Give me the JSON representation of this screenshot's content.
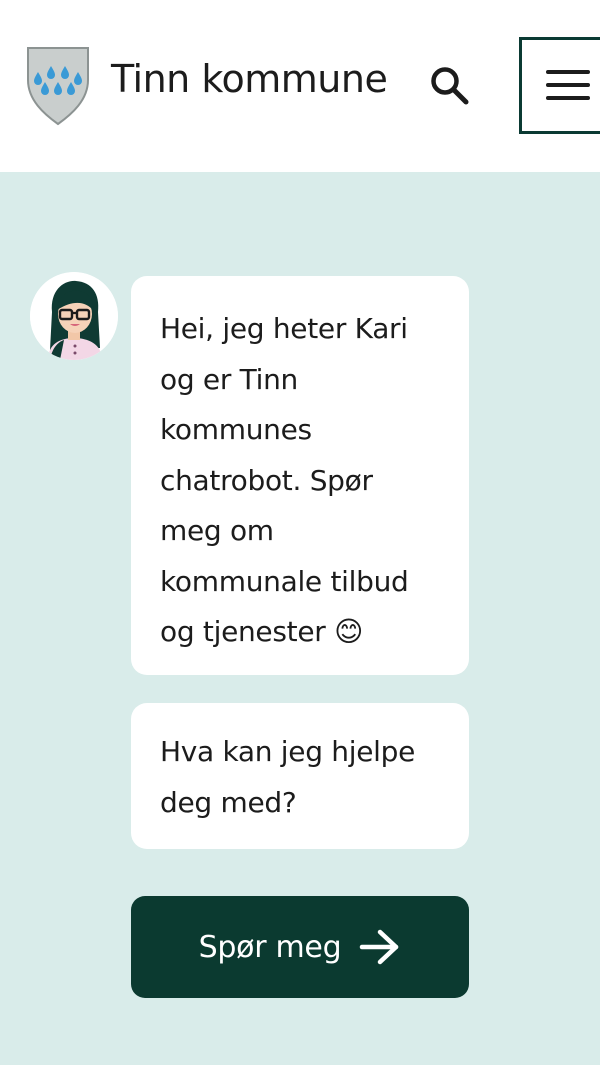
{
  "header": {
    "site_name": "Tinn kommune",
    "logo_icon": "coat-of-arms-shield-icon",
    "search_icon": "search-icon",
    "menu_icon": "hamburger-menu-icon"
  },
  "chat": {
    "avatar_icon": "chatbot-kari-avatar",
    "messages": [
      "Hei, jeg heter Kari og er Tinn kommunes chatrobot. Spør meg om kommunale tilbud og tjenester 😊",
      "Hva kan jeg hjelpe deg med?"
    ],
    "cta_label": "Spør meg",
    "cta_icon": "arrow-right-icon"
  },
  "colors": {
    "page_background": "#d9ecea",
    "header_background": "#ffffff",
    "accent_dark_green": "#0b3a30",
    "shield_gray": "#c8cdcc",
    "drop_blue": "#3a9ad6"
  }
}
